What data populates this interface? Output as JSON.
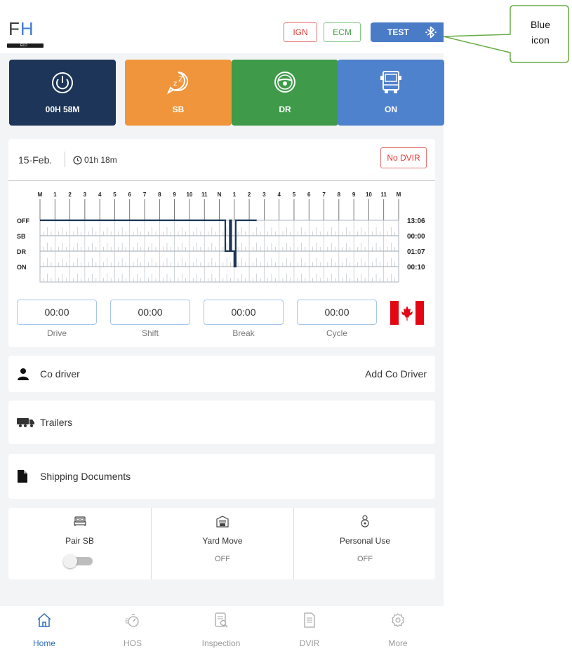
{
  "header": {
    "logo": {
      "text_f": "F",
      "text_h": "H",
      "sub": "ELD"
    },
    "chips": {
      "ign": "IGN",
      "ecm": "ECM",
      "test": "TEST"
    },
    "bluetooth_icon": "bluetooth-icon",
    "bluetooth_color": "#ffffff"
  },
  "status_tiles": [
    {
      "label": "00H 58M",
      "icon": "power-icon",
      "color": "#1c3558"
    },
    {
      "label": "SB",
      "icon": "sleep-icon",
      "color": "#f0953b"
    },
    {
      "label": "DR",
      "icon": "steering-wheel-icon",
      "color": "#3f9a4a"
    },
    {
      "label": "ON",
      "icon": "truck-icon",
      "color": "#4f82cc"
    }
  ],
  "log": {
    "date": "15-Feb.",
    "time": "01h 18m",
    "dvir_badge": "No DVIR",
    "hour_labels": [
      "M",
      "1",
      "2",
      "3",
      "4",
      "5",
      "6",
      "7",
      "8",
      "9",
      "10",
      "11",
      "N",
      "1",
      "2",
      "3",
      "4",
      "5",
      "6",
      "7",
      "8",
      "9",
      "10",
      "11",
      "M"
    ],
    "rows": [
      {
        "label": "OFF",
        "total": "13:06"
      },
      {
        "label": "SB",
        "total": "00:00"
      },
      {
        "label": "DR",
        "total": "01:07"
      },
      {
        "label": "ON",
        "total": "00:10"
      }
    ],
    "counters": [
      {
        "value": "00:00",
        "label": "Drive"
      },
      {
        "value": "00:00",
        "label": "Shift"
      },
      {
        "value": "00:00",
        "label": "Break"
      },
      {
        "value": "00:00",
        "label": "Cycle"
      }
    ],
    "flag": "canada-flag-icon",
    "line_color": "#1c3558"
  },
  "rows": {
    "codriver": {
      "label": "Co driver",
      "action": "Add Co Driver"
    },
    "trailers": {
      "label": "Trailers"
    },
    "documents": {
      "label": "Shipping Documents"
    }
  },
  "toggles": [
    {
      "label": "Pair SB",
      "state": "",
      "icon": "bed-icon"
    },
    {
      "label": "Yard Move",
      "state": "OFF",
      "icon": "garage-icon"
    },
    {
      "label": "Personal Use",
      "state": "OFF",
      "icon": "driver-icon"
    }
  ],
  "nav": [
    {
      "label": "Home",
      "icon": "home-icon",
      "active": true
    },
    {
      "label": "HOS",
      "icon": "stopwatch-icon",
      "active": false
    },
    {
      "label": "Inspection",
      "icon": "inspection-icon",
      "active": false
    },
    {
      "label": "DVIR",
      "icon": "document-icon",
      "active": false
    },
    {
      "label": "More",
      "icon": "settings-icon",
      "active": false
    }
  ],
  "callout": {
    "line1": "Blue",
    "line2": "icon",
    "border_color": "#6aab48"
  }
}
